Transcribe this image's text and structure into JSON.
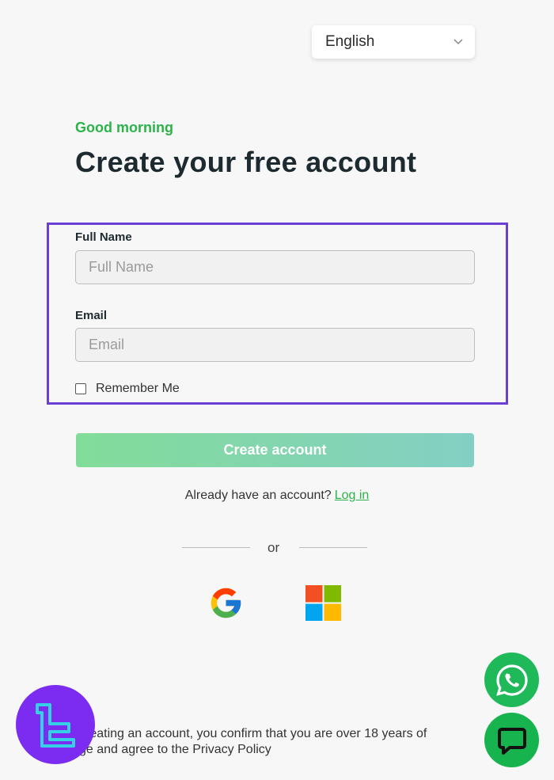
{
  "language_select": {
    "value": "English"
  },
  "header": {
    "greeting": "Good morning",
    "title": "Create your free account"
  },
  "form": {
    "full_name": {
      "label": "Full Name",
      "placeholder": "Full Name",
      "value": ""
    },
    "email": {
      "label": "Email",
      "placeholder": "Email",
      "value": ""
    },
    "remember_me": {
      "label": "Remember Me",
      "checked": false
    },
    "submit_label": "Create account"
  },
  "login_prompt": {
    "text": "Already have an account?",
    "link": "Log in"
  },
  "divider": {
    "text": "or"
  },
  "social": [
    {
      "name": "google",
      "icon": "google-icon"
    },
    {
      "name": "microsoft",
      "icon": "microsoft-icon"
    }
  ],
  "footer": {
    "line1": "creating an account, you confirm that you are over 18 years of",
    "line2": "ge and agree to the Privacy Policy"
  },
  "floating": {
    "whatsapp_icon": "whatsapp-icon",
    "chat_icon": "chat-bubble-icon"
  },
  "colors": {
    "accent_green": "#2bb34a",
    "highlight_purple": "#6a3fd4",
    "button_gradient_start": "#82dc99",
    "button_gradient_end": "#84cfc4",
    "brand_purple": "#7c2cf0",
    "whatsapp_green": "#1fb95a"
  }
}
